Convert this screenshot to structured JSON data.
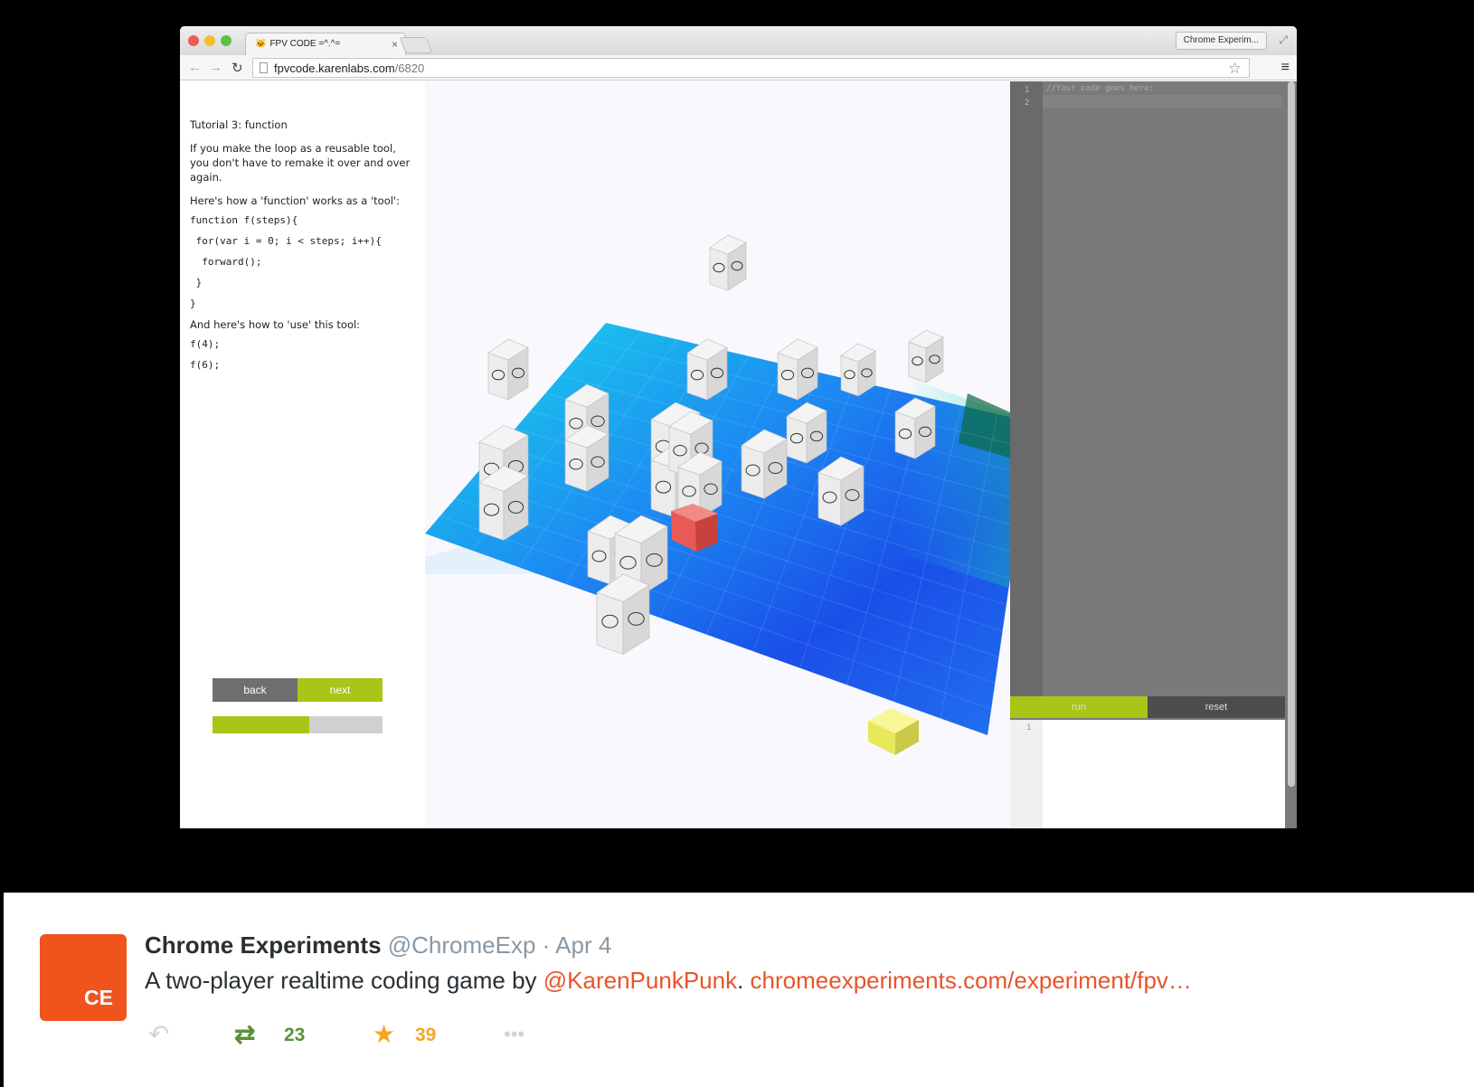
{
  "browser": {
    "tab_title": "FPV CODE =^.^=",
    "tab_close": "×",
    "profile_label": "Chrome Experim...",
    "url_host": "fpvcode.karenlabs.com",
    "url_path": "/6820"
  },
  "tutorial": {
    "title": "Tutorial 3: function",
    "intro": "If you make the loop as a reusable tool, you don't have to remake it over and over again.",
    "how_label": "Here's how a 'function' works as a 'tool':",
    "function_code": "function f(steps){\n for(var i = 0; i < steps; i++){\n  forward();\n }\n}",
    "use_label": "And here's how to 'use' this tool:",
    "use_code": "f(4);\nf(6);"
  },
  "navigation": {
    "back_label": "back",
    "next_label": "next",
    "progress": 0.57
  },
  "editor": {
    "line_numbers": "1\n2",
    "code": "//Your code goes here:",
    "run_label": "run",
    "reset_label": "reset",
    "console_line_number": "1"
  },
  "tweet": {
    "avatar_text": "CE",
    "name": "Chrome Experiments",
    "handle": "@ChromeExp",
    "separator": "·",
    "date": "Apr 4",
    "text_before": "A two-player realtime coding game by ",
    "mention": "@KarenPunkPunk",
    "text_mid": ". ",
    "link": "chromeexperiments.com/experiment/fpv…",
    "retweet_count": "23",
    "favorite_count": "39"
  },
  "colors": {
    "accent_green": "#a7c618",
    "button_gray": "#6f6f6f",
    "brand_orange": "#f0541d",
    "link_orange": "#e8542a",
    "retweet_green": "#5c913b",
    "favorite_gold": "#f5a623",
    "player_red": "#e85a55",
    "goal_yellow": "#f1f15a"
  },
  "icons": {
    "reply": "reply-arrow-icon",
    "retweet": "retweet-icon",
    "favorite": "star-icon",
    "more": "more-dots-icon"
  }
}
